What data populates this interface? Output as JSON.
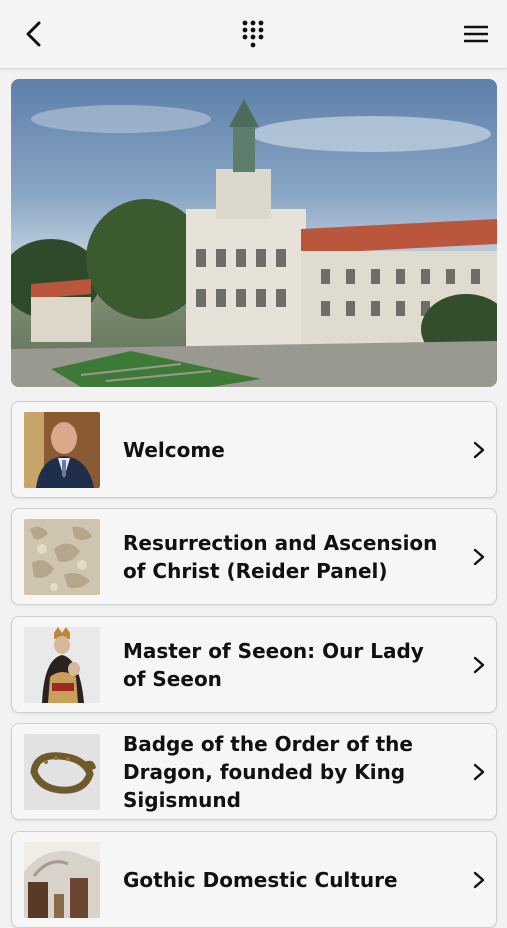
{
  "header": {
    "back_icon": "chevron-left-icon",
    "center_icon": "dialpad-icon",
    "menu_icon": "hamburger-menu-icon"
  },
  "hero": {
    "alt": "Museum building aerial photo"
  },
  "items": [
    {
      "label": "Welcome",
      "thumb": "portrait-thumb"
    },
    {
      "label": "Resurrection and Ascension of Christ (Reider Panel)",
      "thumb": "ivory-relief-thumb"
    },
    {
      "label": "Master of Seeon: Our Lady of Seeon",
      "thumb": "madonna-statue-thumb"
    },
    {
      "label": "Badge of the Order of the Dragon, founded by King Sigismund",
      "thumb": "dragon-badge-thumb"
    },
    {
      "label": "Gothic Domestic Culture",
      "thumb": "gothic-room-thumb"
    }
  ]
}
